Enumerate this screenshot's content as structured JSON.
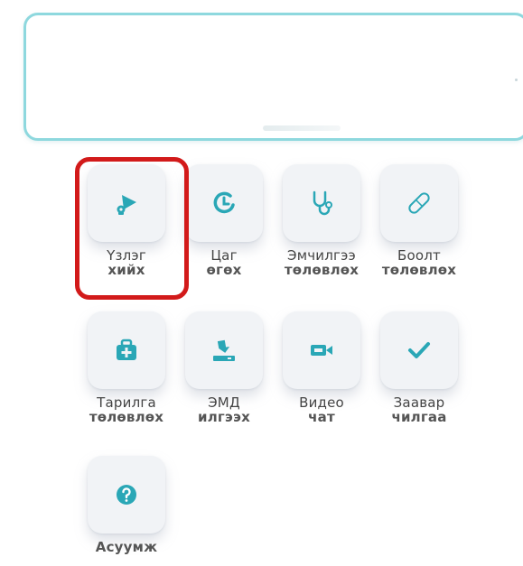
{
  "top_card": {},
  "tiles": [
    {
      "line1": "Үзлэг",
      "line2": "хийх",
      "icon": "telescope-icon"
    },
    {
      "line1": "Цаг",
      "line2": "өгөх",
      "icon": "clock-icon"
    },
    {
      "line1": "Эмчилгээ",
      "line2": "төлөвлөх",
      "icon": "stethoscope-icon"
    },
    {
      "line1": "Боолт",
      "line2": "төлөвлөх",
      "icon": "bandage-icon"
    },
    {
      "line1": "Тарилга",
      "line2": "төлөвлөх",
      "icon": "medical-kit-icon"
    },
    {
      "line1": "ЭМД",
      "line2": "илгээх",
      "icon": "upload-tray-icon"
    },
    {
      "line1": "Видео",
      "line2": "чат",
      "icon": "video-camera-icon"
    },
    {
      "line1": "Заавар",
      "line2": "чилгаа",
      "icon": "checkmark-icon"
    },
    {
      "line1": "Асуумж",
      "line2": "",
      "icon": "question-circle-icon"
    }
  ],
  "colors": {
    "accent": "#2aa7b6",
    "card_border": "#8ed8de",
    "highlight": "#d21a1a",
    "tile_bg": "#f1f3f6"
  }
}
